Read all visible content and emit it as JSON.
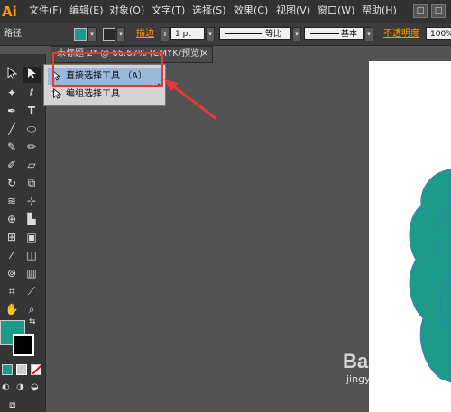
{
  "app": {
    "logo": "Ai"
  },
  "menu": [
    "文件(F)",
    "编辑(E)",
    "对象(O)",
    "文字(T)",
    "选择(S)",
    "效果(C)",
    "视图(V)",
    "窗口(W)",
    "帮助(H)"
  ],
  "window_buttons": [
    "—",
    "□"
  ],
  "control_bar": {
    "object_label": "路径",
    "stroke_label": "描边",
    "stroke_weight": "1 pt",
    "profile_label": "等比",
    "brush_label": "基本",
    "opacity_label": "不透明度",
    "opacity_value": "100%"
  },
  "document_tab": {
    "title": "未标题-2* @ 66.67% (CMYK/预览)",
    "close": "×"
  },
  "flyout": {
    "items": [
      {
        "label": "直接选择工具 （A）",
        "shortcut_visible": true
      },
      {
        "label": "编组选择工具"
      }
    ],
    "expand_arrow": "▸"
  },
  "colors": {
    "fill": "#1e9a8a",
    "stroke": "#000000",
    "accent": "#ff9a00",
    "annotation": "#e53935"
  },
  "watermark": {
    "brand": "Bai",
    "url": "jingyan.baidu.com"
  }
}
